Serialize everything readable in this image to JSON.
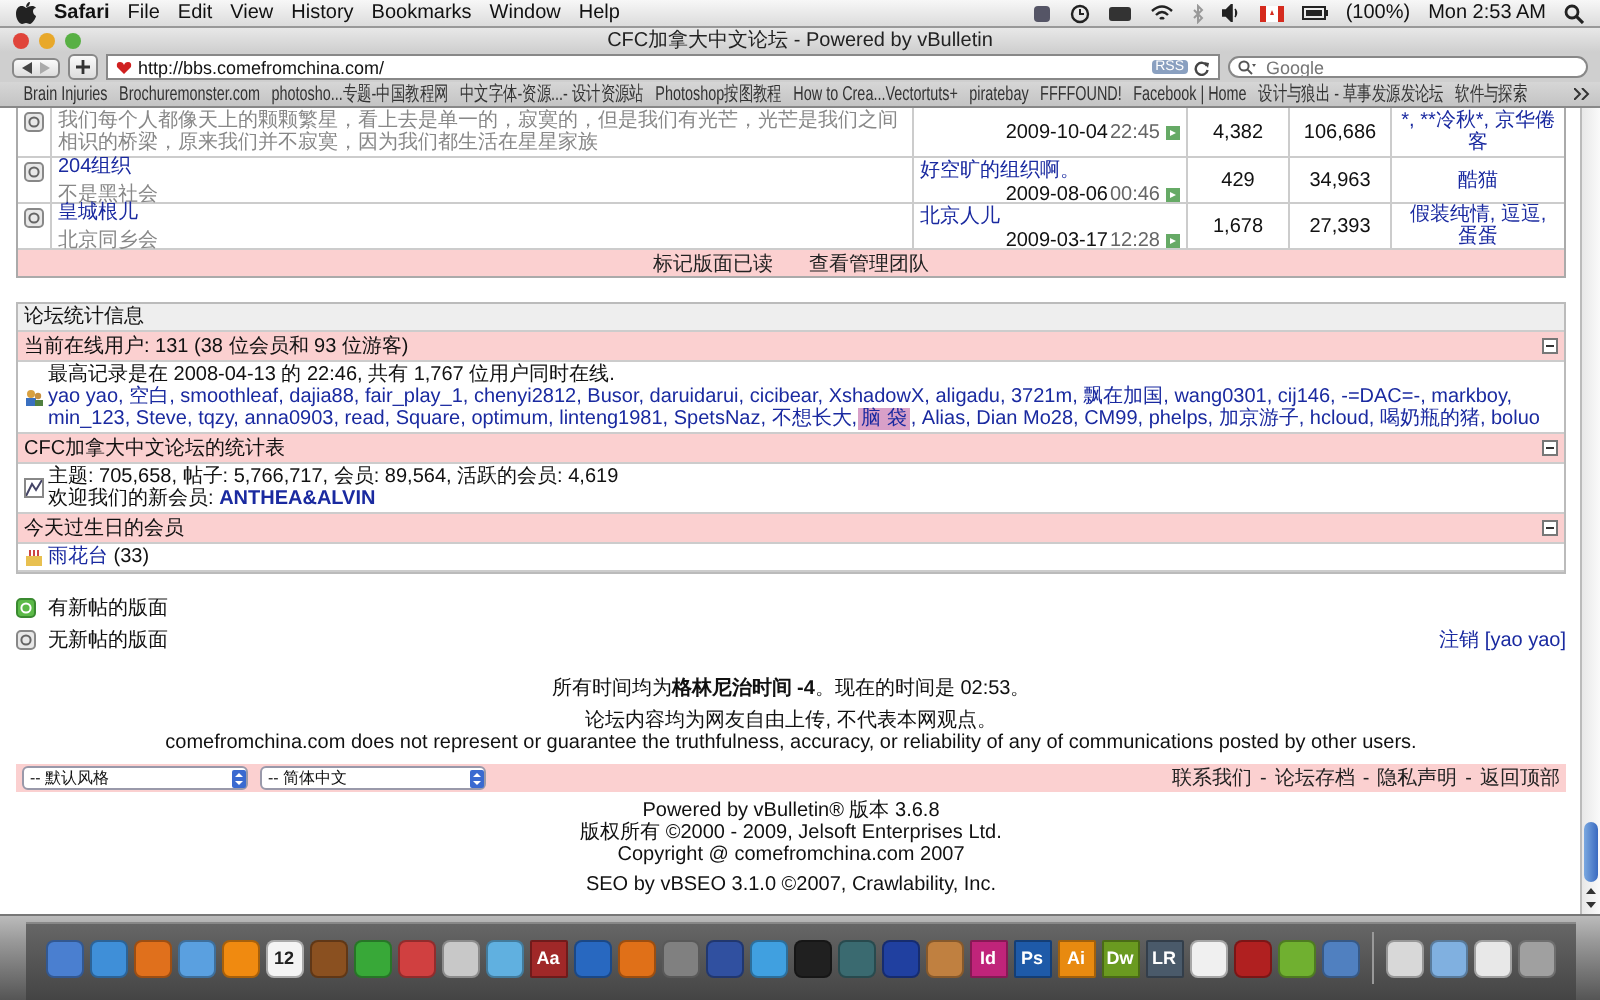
{
  "menu_bar": {
    "app": "Safari",
    "menus": [
      "File",
      "Edit",
      "View",
      "History",
      "Bookmarks",
      "Window",
      "Help"
    ],
    "battery": "(100%)",
    "clock": "Mon 2:53 AM"
  },
  "window": {
    "title": "CFC加拿大中文论坛 - Powered by vBulletin"
  },
  "toolbar": {
    "url": "http://bbs.comefromchina.com/",
    "rss": "RSS",
    "search": {
      "placeholder": "Google"
    }
  },
  "bookmarks": [
    "Brain Injuries",
    "Brochuremonster.com",
    "photosho...专题-中国教程网",
    "中文字体-资源...- 设计资源站",
    "Photoshop按图教程",
    "How to Crea...Vectortuts+",
    "piratebay",
    "FFFFOUND!",
    "Facebook | Home",
    "设计与狼出 - 草事发源发论坛",
    "软件与探索"
  ],
  "forums": [
    {
      "description": "我们每个人都像天上的颗颗繁星，看上去是单一的，寂寞的，但是我们有光芒，光芒是我们之间相识的桥梁，原来我们并不寂寞，因为我们都生活在星星家族",
      "date": "2009-10-04",
      "time": "22:45",
      "threads": "4,382",
      "posts": "106,686",
      "moderators": "*, **冷秋*, 京华倦客"
    },
    {
      "title": "204组织",
      "description": "不是黑社会",
      "last_post": "好空旷的组织啊。",
      "date": "2009-08-06",
      "time": "00:46",
      "threads": "429",
      "posts": "34,963",
      "moderators": "酷猫"
    },
    {
      "title": "皇城根儿",
      "description": "北京同乡会",
      "last_post": "北京人儿",
      "date": "2009-03-17",
      "time": "12:28",
      "threads": "1,678",
      "posts": "27,393",
      "moderators": "假装纯情, 逗逗, 蛋蛋"
    }
  ],
  "forum_actions": [
    "标记版面已读",
    "查看管理团队"
  ],
  "stats": {
    "title": "论坛统计信息",
    "online": {
      "heading": "当前在线用户: 131 (38 位会员和 93 位游客)",
      "record": "最高记录是在 2008-04-13 的 22:46, 共有 1,767 位用户同时在线.",
      "members": [
        {
          "name": "yao yao,",
          "highlighted": false
        },
        {
          "name": "空白,",
          "highlighted": false
        },
        {
          "name": "smoothleaf,",
          "highlighted": false
        },
        {
          "name": "dajia88,",
          "highlighted": false
        },
        {
          "name": "fair_play_1,",
          "highlighted": false
        },
        {
          "name": "chenyi2812,",
          "highlighted": false
        },
        {
          "name": "Busor,",
          "highlighted": false
        },
        {
          "name": "daruidarui,",
          "highlighted": false
        },
        {
          "name": "cicibear,",
          "highlighted": false
        },
        {
          "name": "XshadowX,",
          "highlighted": false
        },
        {
          "name": "aligadu,",
          "highlighted": false
        },
        {
          "name": "3721m,",
          "highlighted": false
        },
        {
          "name": "飘在加国,",
          "highlighted": false
        },
        {
          "name": "wang0301,",
          "highlighted": false
        },
        {
          "name": "cij146,",
          "highlighted": false
        },
        {
          "name": "-=DAC=-,",
          "highlighted": false
        },
        {
          "name": "markboy,",
          "highlighted": false
        },
        {
          "name": "min_123,",
          "highlighted": false
        },
        {
          "name": "Steve,",
          "highlighted": false
        },
        {
          "name": "tqzy,",
          "highlighted": false
        },
        {
          "name": "anna0903,",
          "highlighted": false
        },
        {
          "name": "read,",
          "highlighted": false
        },
        {
          "name": "Square,",
          "highlighted": false
        },
        {
          "name": "optimum,",
          "highlighted": false
        },
        {
          "name": "linteng1981,",
          "highlighted": false
        },
        {
          "name": "SpetsNaz,",
          "highlighted": false
        },
        {
          "name": "不想长大,",
          "highlighted": false
        },
        {
          "name": "脑 袋",
          "highlighted": true
        },
        {
          "name": ", Alias,",
          "highlighted": false
        },
        {
          "name": "Dian Mo28,",
          "highlighted": false
        },
        {
          "name": "CM99,",
          "highlighted": false
        },
        {
          "name": "phelps,",
          "highlighted": false
        },
        {
          "name": "加京游子,",
          "highlighted": false
        },
        {
          "name": "hcloud,",
          "highlighted": false
        },
        {
          "name": "喝奶瓶的猪,",
          "highlighted": false
        },
        {
          "name": "boluo",
          "highlighted": false
        }
      ]
    },
    "totals": {
      "heading": "CFC加拿大中文论坛的统计表",
      "line": "主题: 705,658, 帖子: 5,766,717, 会员: 89,564, 活跃的会员: 4,619",
      "welcome": "欢迎我们的新会员: ",
      "new_member": "ANTHEA&ALVIN"
    },
    "birthdays": {
      "heading": "今天过生日的会员",
      "member": "雨花台",
      "age": "(33)"
    }
  },
  "legend": [
    {
      "kind": "new",
      "label": "有新帖的版面"
    },
    {
      "kind": "old",
      "label": "无新帖的版面"
    }
  ],
  "logout": "注销 [yao yao]",
  "footer": {
    "timezone": "所有时间均为**格林尼治时间 -4**。现在的时间是 02:53。",
    "disclaimer_cn": "论坛内容均为网友自由上传,   不代表本网观点。",
    "disclaimer_en": "comefromchina.com does not represent or guarantee the truthfulness, accuracy, or reliability of any of communications posted by other users.",
    "selects": [
      "-- 默认风格",
      "-- 简体中文"
    ],
    "links": [
      {
        "kind": "link",
        "text": "联系我们"
      },
      {
        "kind": "separator",
        "text": "-"
      },
      {
        "kind": "link",
        "text": "论坛存档"
      },
      {
        "kind": "separator",
        "text": "-"
      },
      {
        "kind": "link",
        "text": "隐私声明"
      },
      {
        "kind": "separator",
        "text": "-"
      },
      {
        "kind": "link",
        "text": "返回顶部"
      }
    ],
    "credits": [
      "Powered by vBulletin® 版本 3.6.8",
      "版权所有 ©2000 - 2009, Jelsoft Enterprises Ltd.",
      "Copyright @ comefromchina.com 2007"
    ],
    "seo": "SEO by vBSEO 3.1.0 ©2007, Crawlability, Inc."
  },
  "dock": [
    {
      "color": "#4a7fd0"
    },
    {
      "color": "#3f8fd8"
    },
    {
      "color": "#e0701c"
    },
    {
      "color": "#5aa0e0"
    },
    {
      "color": "#f08a10"
    },
    {
      "label": "12",
      "color": "#f4f4f4"
    },
    {
      "color": "#8a5020"
    },
    {
      "color": "#38a838"
    },
    {
      "color": "#d04040"
    },
    {
      "color": "#c8c8c8"
    },
    {
      "color": "#60b0e0"
    },
    {
      "label": "Aa",
      "color": "#a02828"
    },
    {
      "color": "#2868c0"
    },
    {
      "color": "#e07018"
    },
    {
      "color": "#808080"
    },
    {
      "color": "#3050a0"
    },
    {
      "color": "#40a0e0"
    },
    {
      "color": "#202020"
    },
    {
      "color": "#3a6a70"
    },
    {
      "color": "#2040a0"
    },
    {
      "color": "#c08040"
    },
    {
      "label": "Id",
      "color": "#c0247a"
    },
    {
      "label": "Ps",
      "color": "#1e5aa8"
    },
    {
      "label": "Ai",
      "color": "#e88a10"
    },
    {
      "label": "Dw",
      "color": "#6a9a20"
    },
    {
      "label": "LR",
      "color": "#4a5a6a"
    },
    {
      "color": "#f0f0f0"
    },
    {
      "color": "#b02020"
    },
    {
      "color": "#70b030"
    },
    {
      "color": "#5080c0"
    },
    {
      "color": "#d8d8d8"
    },
    {
      "color": "#80b0e0"
    },
    {
      "color": "#e8e8e8"
    },
    {
      "color": "#a0a0a0"
    }
  ]
}
